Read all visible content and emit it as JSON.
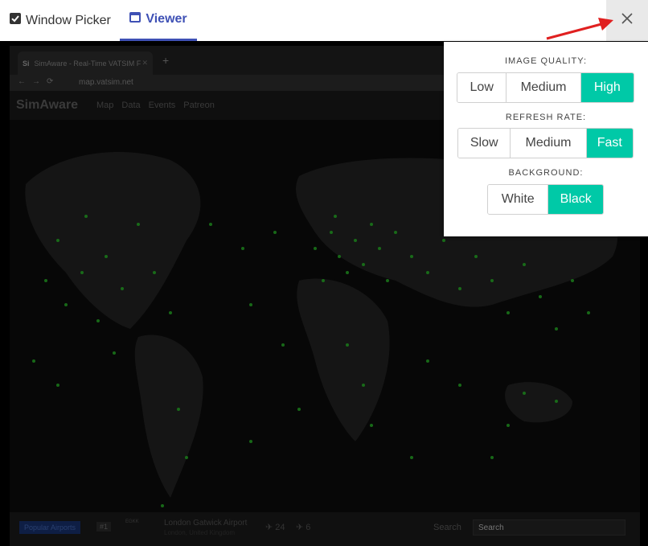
{
  "tabs": {
    "window_picker": "Window Picker",
    "viewer": "Viewer"
  },
  "settings": {
    "image_quality": {
      "label": "IMAGE QUALITY:",
      "options": [
        "Low",
        "Medium",
        "High"
      ],
      "selected": "High"
    },
    "refresh_rate": {
      "label": "REFRESH RATE:",
      "options": [
        "Slow",
        "Medium",
        "Fast"
      ],
      "selected": "Fast"
    },
    "background": {
      "label": "BACKGROUND:",
      "options": [
        "White",
        "Black"
      ],
      "selected": "Black"
    }
  },
  "colors": {
    "accent": "#00c9a7",
    "tab_active": "#3f51b5",
    "arrow": "#e02020"
  },
  "captured_window": {
    "tab_title": "SimAware - Real-Time VATSIM F",
    "favicon_text": "Si",
    "url": "map.vatsim.net",
    "site_logo": "SimAware",
    "menu": [
      "Map",
      "Data",
      "Events",
      "Patreon"
    ],
    "bottom": {
      "popular_airports": "Popular Airports",
      "rank": "#1",
      "icao": "EGKK",
      "airport_name": "London Gatwick Airport",
      "airport_location": "London, United Kingdom",
      "departures": "24",
      "arrivals": "6",
      "search_label": "Search",
      "search_placeholder": "Search"
    }
  }
}
